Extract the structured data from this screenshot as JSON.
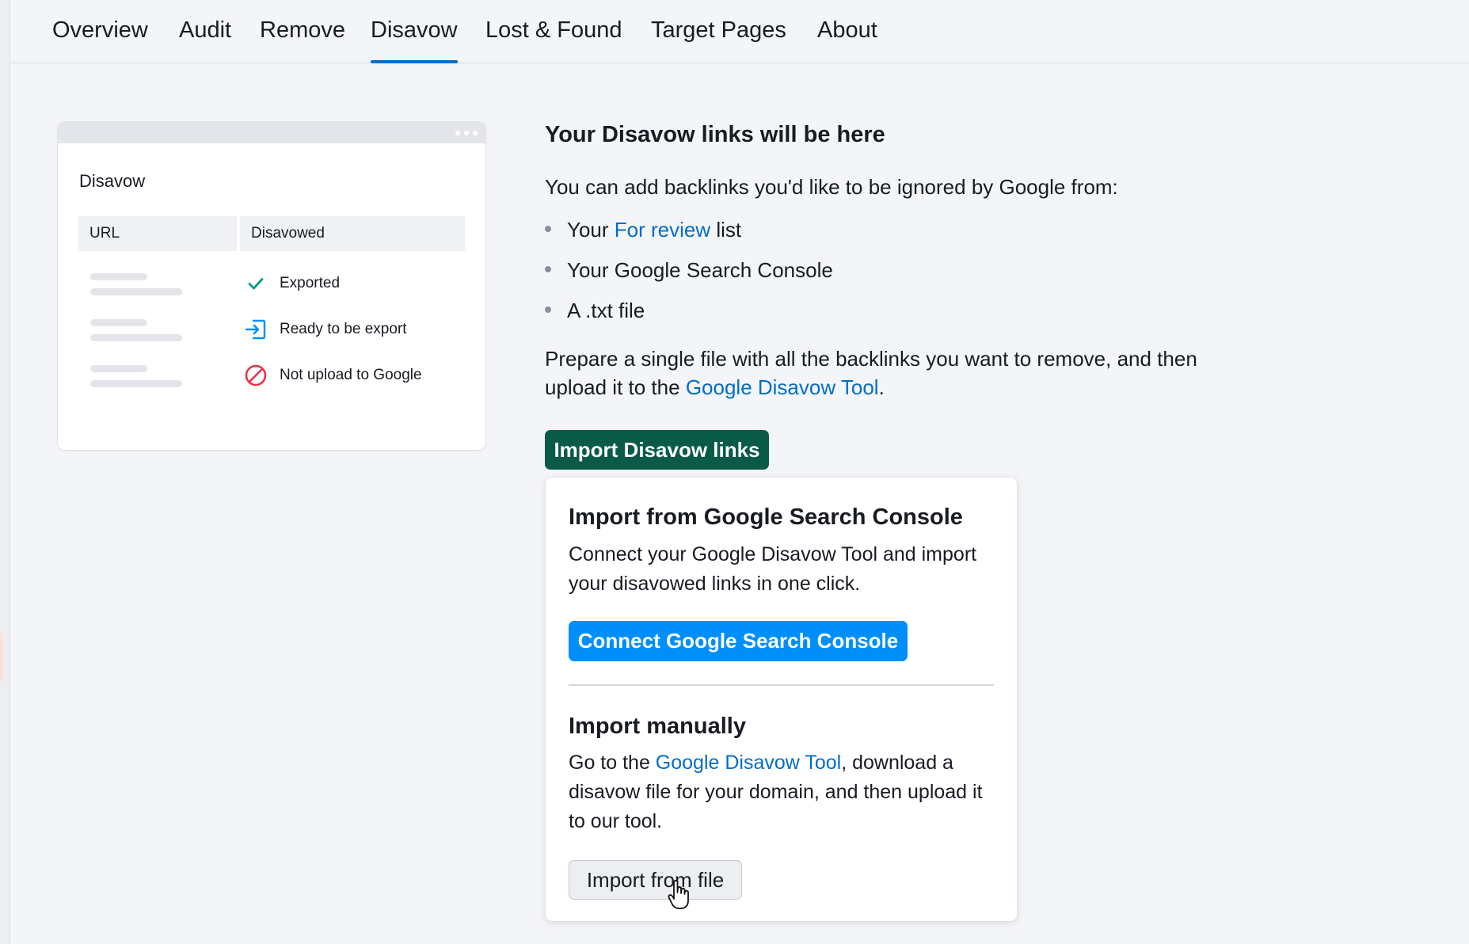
{
  "tabs": [
    {
      "label": "Overview"
    },
    {
      "label": "Audit"
    },
    {
      "label": "Remove"
    },
    {
      "label": "Disavow",
      "active": true
    },
    {
      "label": "Lost & Found"
    },
    {
      "label": "Target Pages"
    },
    {
      "label": "About"
    }
  ],
  "illustration": {
    "title": "Disavow",
    "col_url": "URL",
    "col_disavowed": "Disavowed",
    "rows": [
      {
        "status": "Exported",
        "icon": "check-icon"
      },
      {
        "status": "Ready to be export",
        "icon": "export-icon"
      },
      {
        "status": "Not upload to Google",
        "icon": "prohibited-icon"
      }
    ]
  },
  "main": {
    "heading": "Your Disavow links will be here",
    "intro": "You can add backlinks you'd like to be ignored by Google from:",
    "bullets": {
      "b1_prefix": "Your ",
      "b1_link": "For review",
      "b1_suffix": " list",
      "b2": "Your Google Search Console",
      "b3": "A .txt file"
    },
    "prepare_text": "Prepare a single file with all the backlinks you want to remove, and then upload it to the ",
    "prepare_link": "Google Disavow Tool",
    "prepare_end": ".",
    "import_button": "Import Disavow links"
  },
  "dropdown": {
    "gsc_heading": "Import from Google Search Console",
    "gsc_text": "Connect your Google Disavow Tool and import your disavowed links in one click.",
    "connect_button": "Connect Google Search Console",
    "manual_heading": "Import manually",
    "manual_prefix": "Go to the ",
    "manual_link": "Google Disavow Tool",
    "manual_suffix": ", download a disavow file for your domain, and then upload it to our tool.",
    "file_button": "Import from file"
  },
  "colors": {
    "accent_blue": "#006dca",
    "primary_green": "#0a5a48",
    "connect_blue": "#008ff8",
    "check_green": "#009f81",
    "error_red": "#e5334b"
  }
}
